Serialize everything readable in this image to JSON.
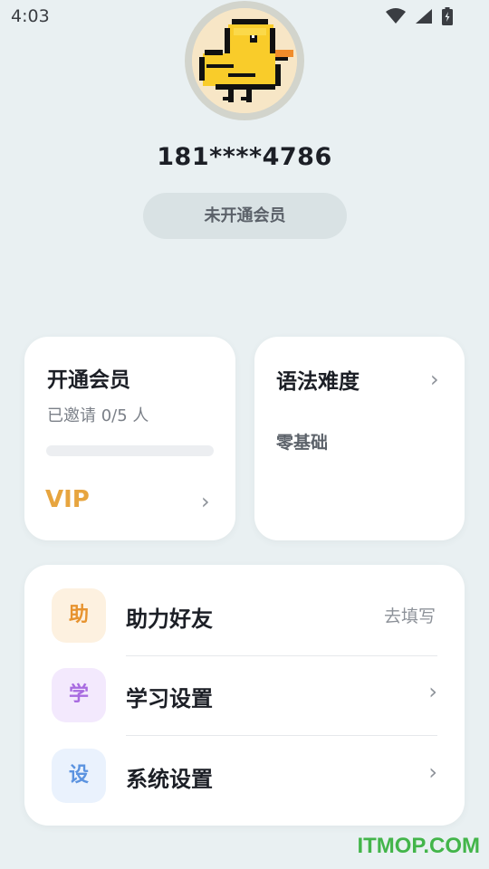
{
  "status_bar": {
    "time": "4:03",
    "icons": [
      "wifi-icon",
      "signal-icon",
      "battery-icon"
    ]
  },
  "profile": {
    "avatar": "pixel-duck-avatar",
    "phone": "181****4786",
    "membership_status": "未开通会员"
  },
  "vip_card": {
    "title": "开通会员",
    "invite_text": "已邀请 0/5 人",
    "progress": 0,
    "vip_label": "VIP",
    "accent_color": "#e7a53f"
  },
  "grammar_card": {
    "title": "语法难度",
    "level": "零基础"
  },
  "menu": {
    "items": [
      {
        "icon_char": "助",
        "label": "助力好友",
        "right_text": "去填写",
        "icon_bg": "#fdf1e0",
        "icon_color": "#e7932f"
      },
      {
        "icon_char": "学",
        "label": "学习设置",
        "right_text": "",
        "icon_bg": "#f3e9fd",
        "icon_color": "#a86be0"
      },
      {
        "icon_char": "设",
        "label": "系统设置",
        "right_text": "",
        "icon_bg": "#eaf2fd",
        "icon_color": "#5b93e0"
      }
    ]
  },
  "watermark": "ITMOP.COM"
}
